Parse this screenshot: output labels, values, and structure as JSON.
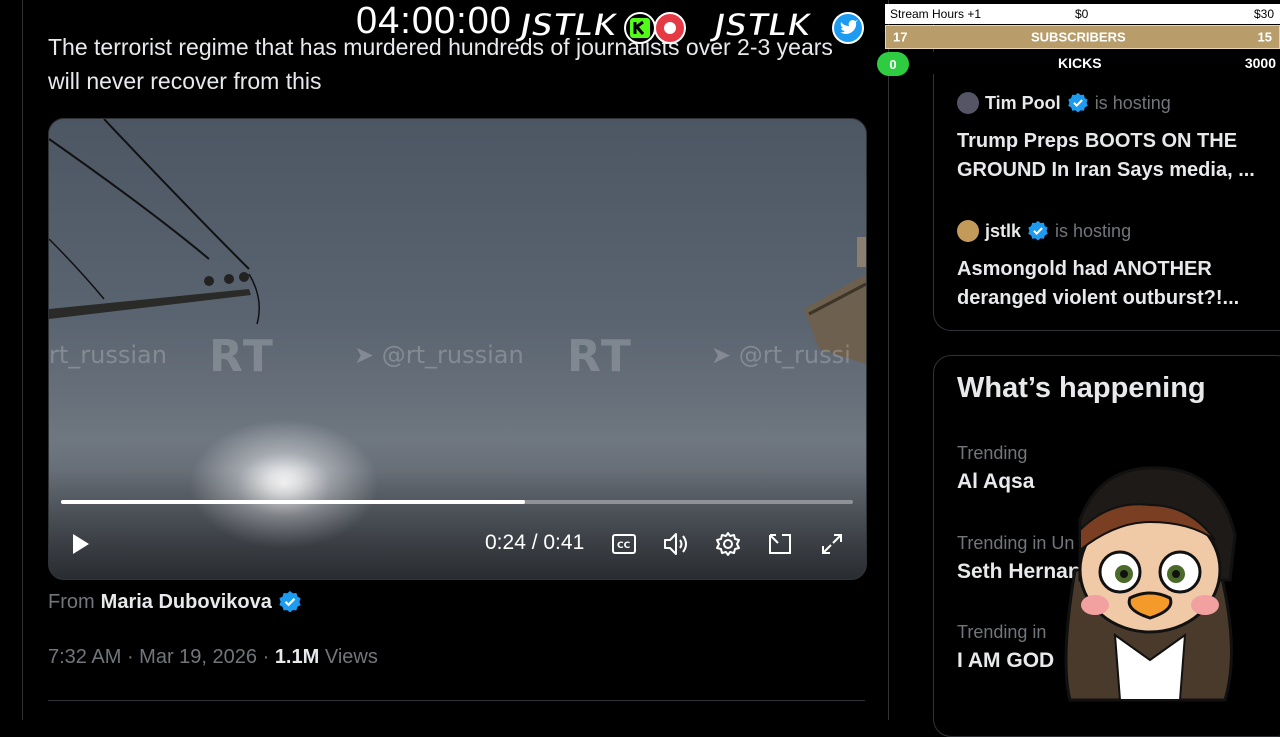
{
  "overlay": {
    "timer": "04:00:00",
    "brand_left": "JSTLK",
    "brand_right": "JSTLK",
    "goals": {
      "stream_hours": {
        "label": "Stream Hours +1",
        "start": "$0",
        "end": "$30"
      },
      "subscribers": {
        "label": "SUBSCRIBERS",
        "current": "17",
        "target": "15"
      },
      "kicks": {
        "label": "KICKS",
        "current": "0",
        "target": "3000"
      }
    }
  },
  "tweet": {
    "text": "The terrorist regime that has murdered hundreds of journalists over 2-3 years will never recover from this",
    "from_label": "From",
    "from_name": "Maria Dubovikova",
    "time": "7:32 AM",
    "date": "Mar 19, 2026",
    "views_count": "1.1M",
    "views_label": "Views"
  },
  "video": {
    "watermarks": [
      "rt_russian",
      "RT",
      "@rt_russian",
      "RT",
      "@rt_russi"
    ],
    "current_time": "0:24",
    "duration": "0:41",
    "time_display": "0:24 / 0:41",
    "progress": 0.586
  },
  "hosting": [
    {
      "name": "Tim Pool",
      "verb": "is hosting",
      "title": "Trump Preps BOOTS ON THE GROUND In Iran Says media, ...",
      "title_l1": "Trump Preps BOOTS ON THE",
      "title_l2": "GROUND In Iran Says media, ..."
    },
    {
      "name": "jstlk",
      "verb": "is hosting",
      "title": "Asmongold had ANOTHER deranged violent outburst?!...",
      "title_l1": "Asmongold had ANOTHER",
      "title_l2": "deranged violent outburst?!..."
    }
  ],
  "trending": {
    "title": "What’s happening",
    "items": [
      {
        "category": "Trending",
        "name": "Al Aqsa"
      },
      {
        "category": "Trending in Un",
        "name": "Seth Hernan"
      },
      {
        "category": "Trending in",
        "name": "I AM GOD"
      }
    ]
  },
  "colors": {
    "verified": "#1d9bf0",
    "kick_green": "#53fc18",
    "goal_gold": "#b89d6a"
  }
}
